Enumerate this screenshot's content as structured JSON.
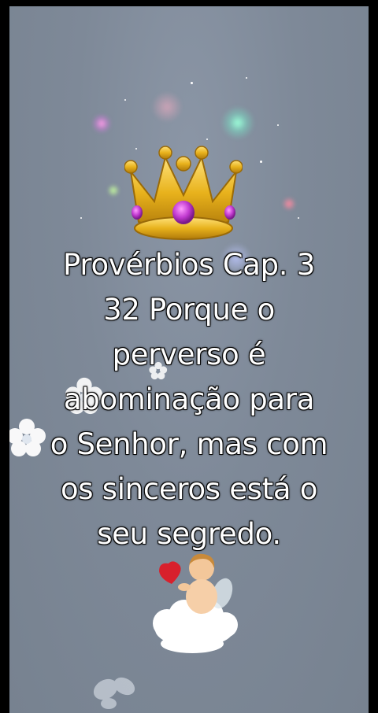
{
  "verse": {
    "lines": [
      "Provérbios Cap. 3",
      "32 Porque o",
      "perverso é",
      "abominação para",
      "o Senhor, mas com",
      "os sinceros está o",
      "seu segredo."
    ]
  },
  "decorations": {
    "top_icon": "crown-icon",
    "bottom_icon": "cherub-with-heart-icon",
    "flower_icon": "white-flower-icon",
    "butterfly_icon": "butterfly-icon"
  },
  "colors": {
    "background": "#7f8a99",
    "text": "#ffffff",
    "crown_gold": "#e8b21c",
    "gem": "#c13ad0"
  }
}
